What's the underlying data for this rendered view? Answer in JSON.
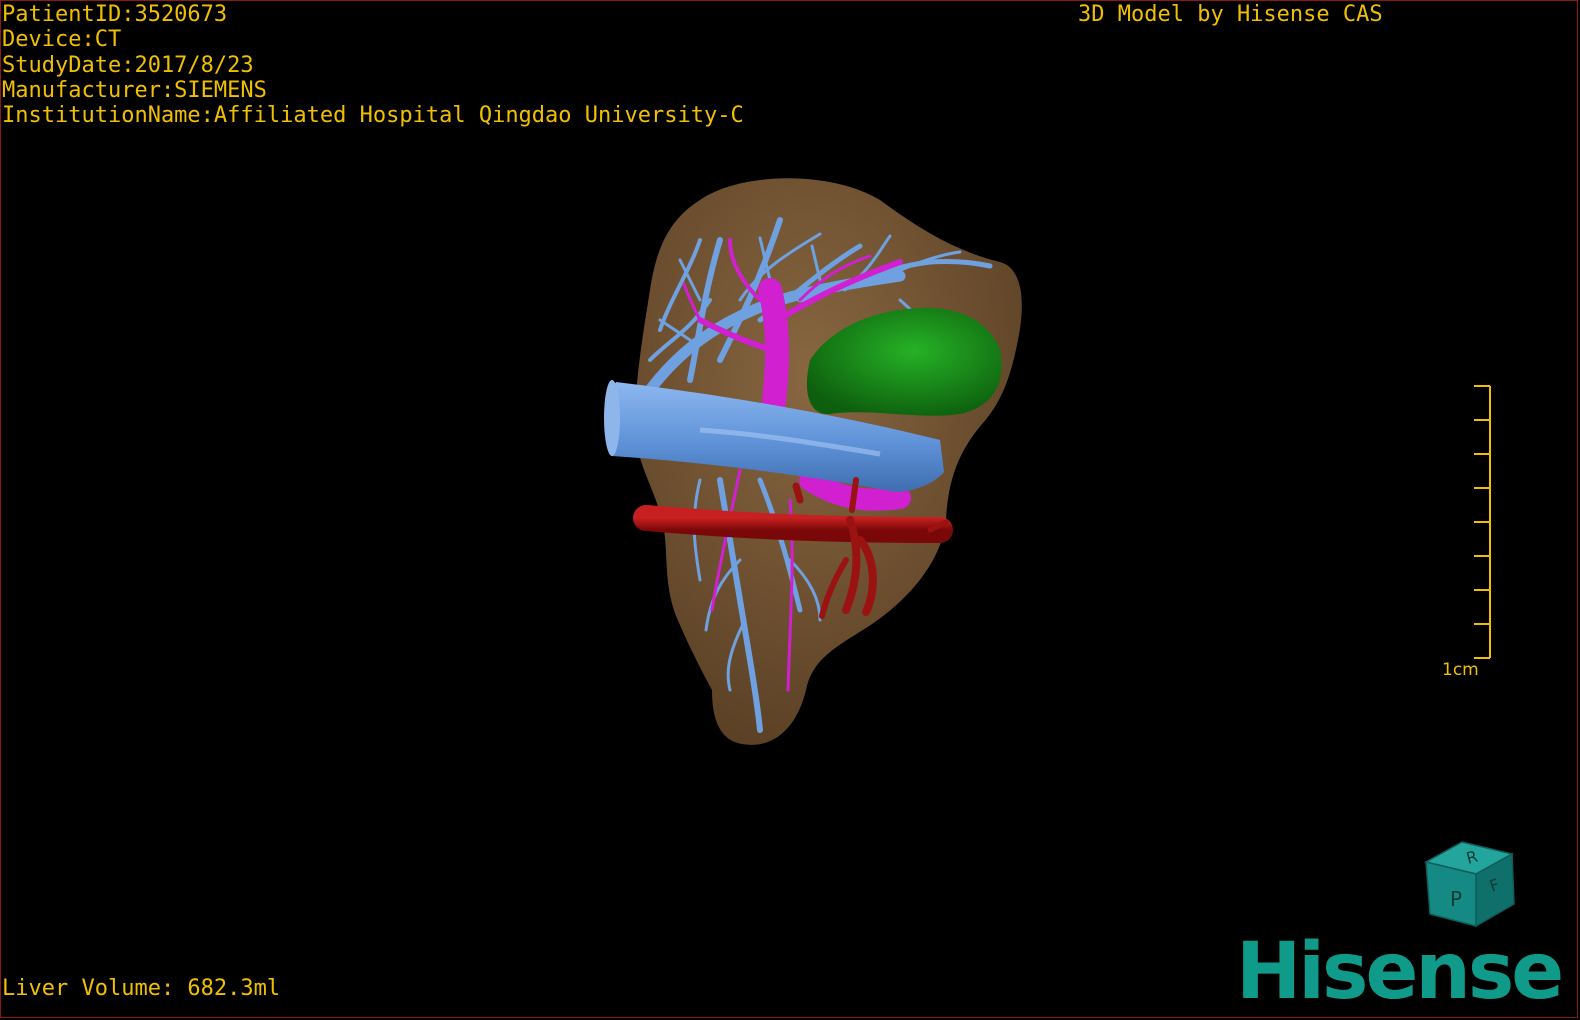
{
  "header": {
    "patient_id": "PatientID:3520673",
    "device": "Device:CT",
    "study_date": "StudyDate:2017/8/23",
    "manufacturer": "Manufacturer:SIEMENS",
    "institution": "InstitutionName:Affiliated Hospital Qingdao University-C",
    "title": "3D Model by Hisense CAS"
  },
  "footer": {
    "liver_volume": "Liver Volume: 682.3ml"
  },
  "scale_bar": {
    "label": "1cm"
  },
  "orientation_cube": {
    "faces": [
      "R",
      "F",
      "P"
    ]
  },
  "brand": {
    "text": "Hisense"
  },
  "colors": {
    "overlay_text": "#f0c000",
    "liver": "#7a5a36",
    "hepatic_vein": "#6fa0e0",
    "portal_vein": "#d020d0",
    "artery": "#a01010",
    "gallbladder": "#1a8a1a",
    "brand": "#0f9a8a"
  }
}
